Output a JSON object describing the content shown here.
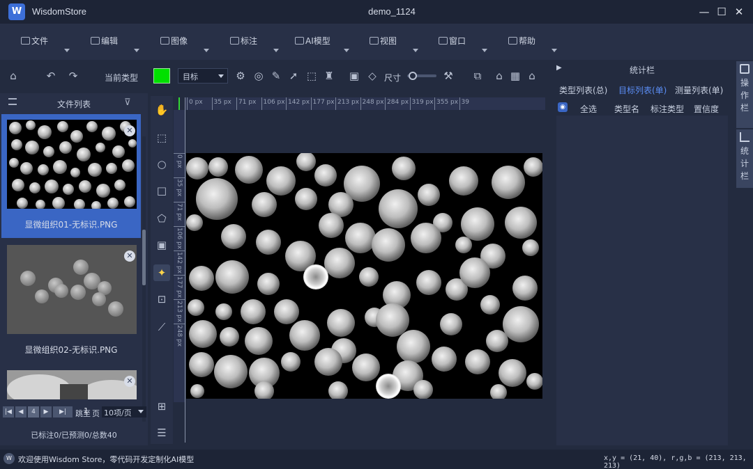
{
  "window": {
    "app_name": "WisdomStore",
    "logo_letter": "W",
    "title": "demo_1124",
    "minimize": "—",
    "maximize": "☐",
    "close": "✕"
  },
  "menu": [
    {
      "label": "文件",
      "icon": "folder-icon"
    },
    {
      "label": "编辑",
      "icon": "edit-icon"
    },
    {
      "label": "图像",
      "icon": "image-icon"
    },
    {
      "label": "标注",
      "icon": "annotate-icon"
    },
    {
      "label": "AI模型",
      "icon": "cube-icon"
    },
    {
      "label": "视图",
      "icon": "view-icon"
    },
    {
      "label": "窗口",
      "icon": "window-icon"
    },
    {
      "label": "帮助",
      "icon": "help-icon"
    }
  ],
  "toolbar": {
    "current_type_label": "当前类型",
    "current_color": "#00e000",
    "type_select_value": "目标",
    "size_label": "尺寸"
  },
  "file_panel": {
    "title": "文件列表",
    "files": [
      {
        "name": "显微组织01-无标识.PNG",
        "selected": true
      },
      {
        "name": "显微组织02-无标识.PNG",
        "selected": false
      },
      {
        "name": "",
        "selected": false
      }
    ],
    "pager": {
      "first": "|◀",
      "prev": "◀",
      "current_page": "4",
      "next": "▶",
      "last": "▶|",
      "to_label": "跳至",
      "page_input": "1",
      "page_unit": "页",
      "per_page": "10项/页"
    },
    "annot_stats": "已标注0/已预测0/总数40"
  },
  "canvas": {
    "ruler_x_labels": [
      "0 px",
      "35 px",
      "71 px",
      "106 px",
      "142 px",
      "177 px",
      "213 px",
      "248 px",
      "284 px",
      "319 px",
      "355 px",
      "39"
    ],
    "ruler_y_labels": [
      "0 px",
      "35 px",
      "71 px",
      "106 px",
      "142 px",
      "177 px",
      "213 px",
      "248 px"
    ]
  },
  "stats_panel": {
    "title": "统计栏",
    "tabs": [
      "类型列表(总)",
      "目标列表(单)",
      "测量列表(单)"
    ],
    "active_tab": 1,
    "columns": [
      "全选",
      "类型名",
      "标注类型",
      "置信度"
    ]
  },
  "side_tabs": [
    {
      "label": "操作栏"
    },
    {
      "label": "统计栏"
    }
  ],
  "status": {
    "logo": "W",
    "message": "欢迎使用Wisdom Store，零代码开发定制化AI模型",
    "coords": "x,y = (21, 40), r,g,b = (213, 213, 213)"
  }
}
